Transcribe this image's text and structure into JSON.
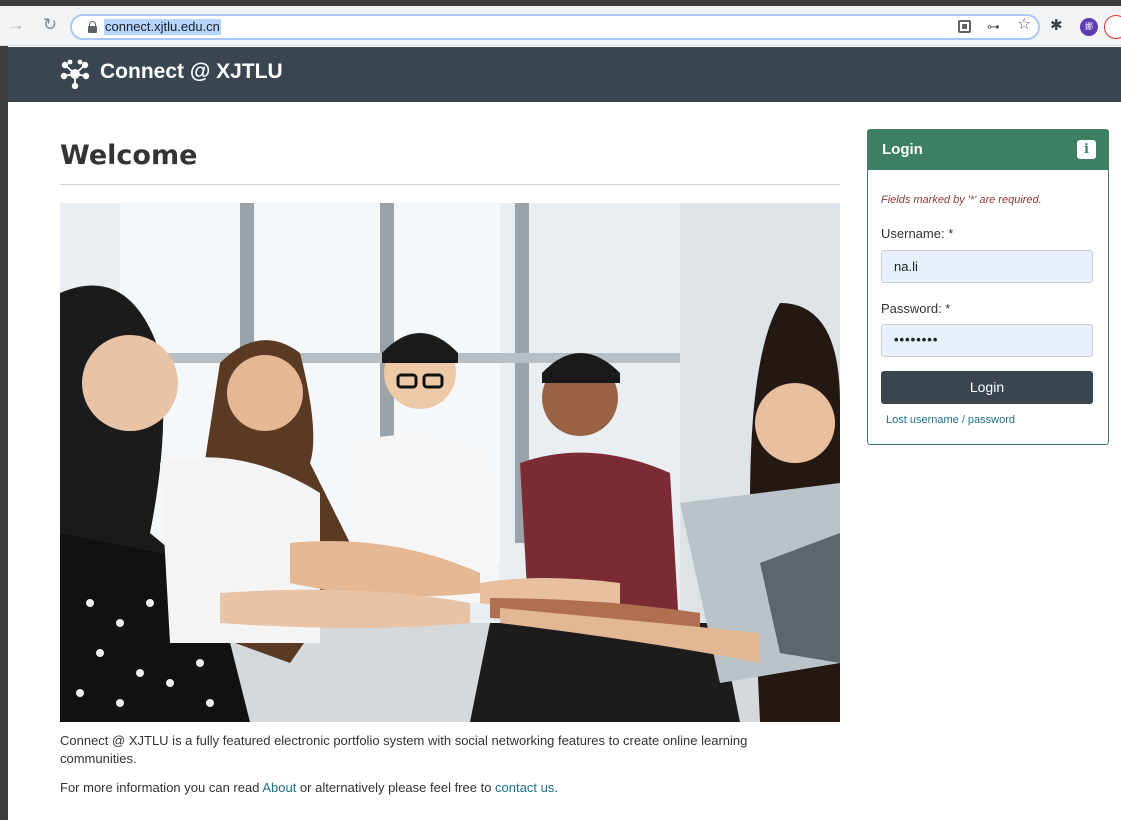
{
  "browser": {
    "url": "connect.xjtlu.edu.cn",
    "icons": [
      "back-arrow-icon",
      "reload-icon",
      "lock-icon",
      "qr-code-icon",
      "key-icon",
      "star-icon",
      "extensions-icon"
    ],
    "avatar_text": "娜"
  },
  "header": {
    "brand": "Connect @ XJTLU"
  },
  "main": {
    "title": "Welcome",
    "description": "Connect @ XJTLU is a fully featured electronic portfolio system with social networking features to create online learning communities.",
    "more_info_prefix": "For more information you can read ",
    "about_link": "About",
    "more_info_middle": " or alternatively please feel free to ",
    "contact_link": "contact us",
    "more_info_suffix": "."
  },
  "login": {
    "title": "Login",
    "required_note": "Fields marked by '*' are required.",
    "username_label": "Username: *",
    "username_value": "na.li",
    "password_label": "Password: *",
    "password_value": "••••••••",
    "button_label": "Login",
    "lost_link": "Lost username / password",
    "info_glyph": "i"
  },
  "colors": {
    "header_bg": "#3a4550",
    "login_accent": "#3d7f63",
    "link": "#1f6f8b"
  }
}
